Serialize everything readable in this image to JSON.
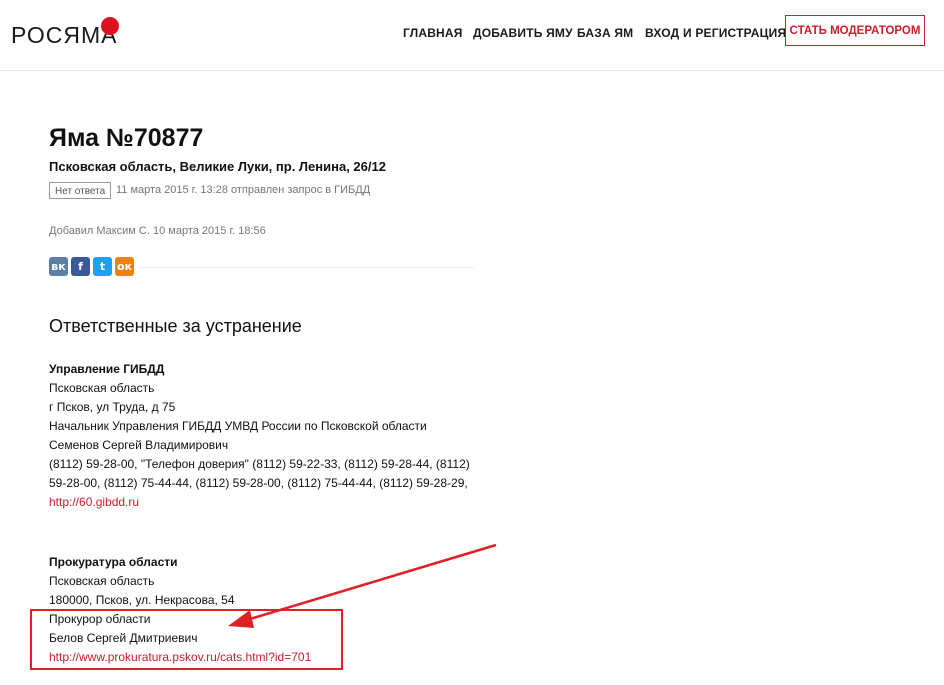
{
  "header": {
    "logo": "РОСЯМА",
    "nav": [
      "ГЛАВНАЯ",
      "ДОБАВИТЬ ЯМУ",
      "БАЗА ЯМ",
      "ВХОД И РЕГИСТРАЦИЯ"
    ],
    "moderator_button": "СТАТЬ МОДЕРАТОРОМ"
  },
  "pit": {
    "title": "Яма №70877",
    "address": "Псковская область, Великие Луки, пр. Ленина, 26/12",
    "badge": "Нет ответа",
    "status": "11 марта 2015 г. 13:28 отправлен запрос в ГИБДД",
    "added": "Добавил Максим С. 10 марта 2015 г. 18:56"
  },
  "share": {
    "icons": [
      "vk-icon",
      "facebook-icon",
      "twitter-icon",
      "odnoklassniki-icon"
    ],
    "colors": [
      "#5b7fa6",
      "#3b5998",
      "#1da1f2",
      "#ee8208"
    ],
    "glyphs": [
      "вк",
      "f",
      "t",
      "ок"
    ]
  },
  "responsible": {
    "heading": "Ответственные за устранение",
    "gibdd": {
      "org": "Управление ГИБДД",
      "region": "Псковская область",
      "address": "г Псков, ул Труда, д 75",
      "position": "Начальник Управления ГИБДД УМВД России по Псковской области",
      "person": "Семенов Сергей Владимирович",
      "phones": "(8112) 59-28-00, \"Телефон доверия\" (8112) 59-22-33, (8112) 59-28-44, (8112) 59-28-00, (8112) 75-44-44, (8112) 59-28-00, (8112) 75-44-44, (8112) 59-28-29,",
      "link": "http://60.gibdd.ru"
    },
    "prosecutor": {
      "org": "Прокуратура области",
      "region": "Псковская область",
      "address": "180000, Псков, ул. Некрасова, 54",
      "position": "Прокурор области",
      "person": "Белов Сергей Дмитриевич",
      "link": "http://www.prokuratura.pskov.ru/cats.html?id=701"
    }
  },
  "annotation": {
    "color": "#e01f26"
  }
}
